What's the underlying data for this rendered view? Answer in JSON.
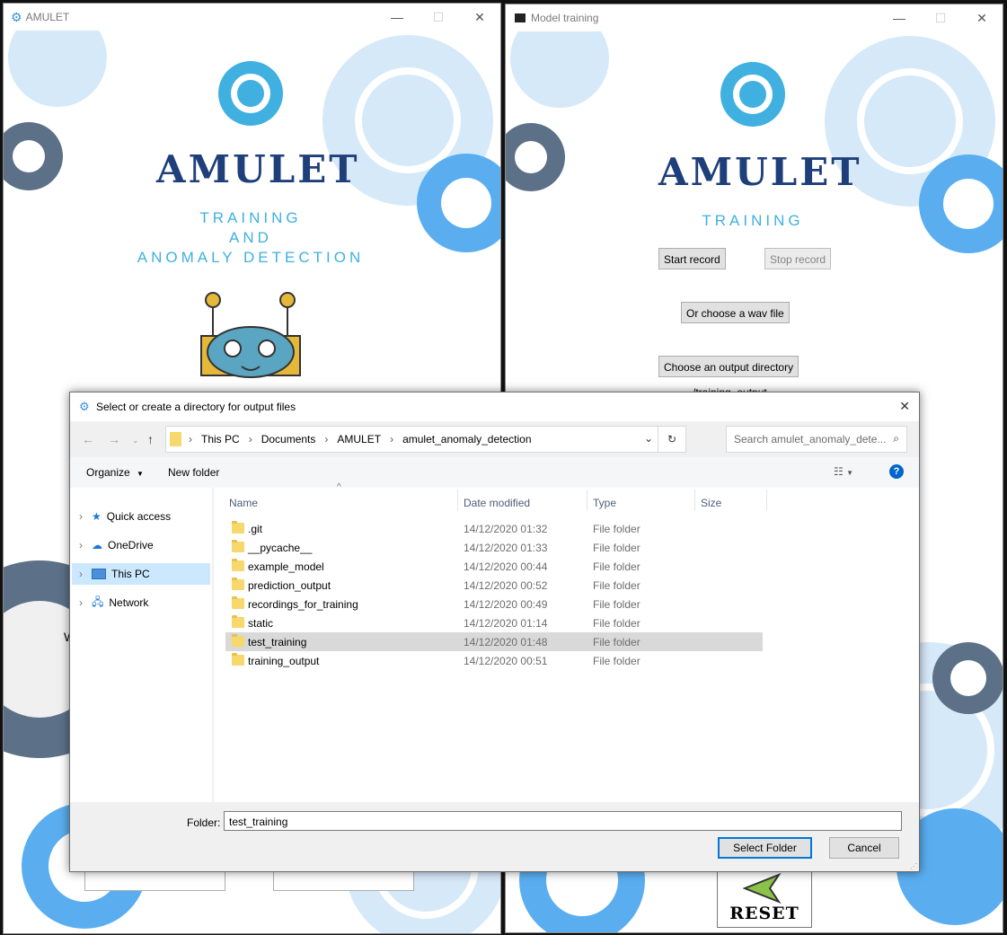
{
  "left_window": {
    "title": "AMULET",
    "logo": "AMULET",
    "subtitle_lines": [
      "TRAINING",
      "AND",
      "ANOMALY DETECTION"
    ],
    "partial_text": "W"
  },
  "right_window": {
    "title": "Model training",
    "logo": "AMULET",
    "subtitle": "TRAINING",
    "start_record": "Start record",
    "stop_record": "Stop record",
    "choose_wav": "Or choose a wav file",
    "choose_output": "Choose an output directory",
    "output_path": "/training_output",
    "reset_label": "RESET"
  },
  "dialog": {
    "title": "Select or create a directory for output files",
    "breadcrumb": [
      "This PC",
      "Documents",
      "AMULET",
      "amulet_anomaly_detection"
    ],
    "search_placeholder": "Search amulet_anomaly_dete...",
    "organize": "Organize",
    "new_folder": "New folder",
    "nav_items": [
      {
        "label": "Quick access",
        "icon": "star-icon"
      },
      {
        "label": "OneDrive",
        "icon": "cloud-icon"
      },
      {
        "label": "This PC",
        "icon": "monitor-icon"
      },
      {
        "label": "Network",
        "icon": "network-icon"
      }
    ],
    "columns": [
      "Name",
      "Date modified",
      "Type",
      "Size"
    ],
    "rows": [
      {
        "name": ".git",
        "date": "14/12/2020 01:32",
        "type": "File folder"
      },
      {
        "name": "__pycache__",
        "date": "14/12/2020 01:33",
        "type": "File folder"
      },
      {
        "name": "example_model",
        "date": "14/12/2020 00:44",
        "type": "File folder"
      },
      {
        "name": "prediction_output",
        "date": "14/12/2020 00:52",
        "type": "File folder"
      },
      {
        "name": "recordings_for_training",
        "date": "14/12/2020 00:49",
        "type": "File folder"
      },
      {
        "name": "static",
        "date": "14/12/2020 01:14",
        "type": "File folder"
      },
      {
        "name": "test_training",
        "date": "14/12/2020 01:48",
        "type": "File folder"
      },
      {
        "name": "training_output",
        "date": "14/12/2020 00:51",
        "type": "File folder"
      }
    ],
    "folder_label": "Folder:",
    "folder_value": "test_training",
    "select_button": "Select Folder",
    "cancel_button": "Cancel"
  },
  "colors": {
    "accent": "#0078d7",
    "logo_dark": "#1f3f7a",
    "subtitle_blue": "#3fb0e0",
    "gear_light": "#d6e9f8",
    "gear_mid": "#5aaef0",
    "gear_dark": "#5c7088"
  }
}
